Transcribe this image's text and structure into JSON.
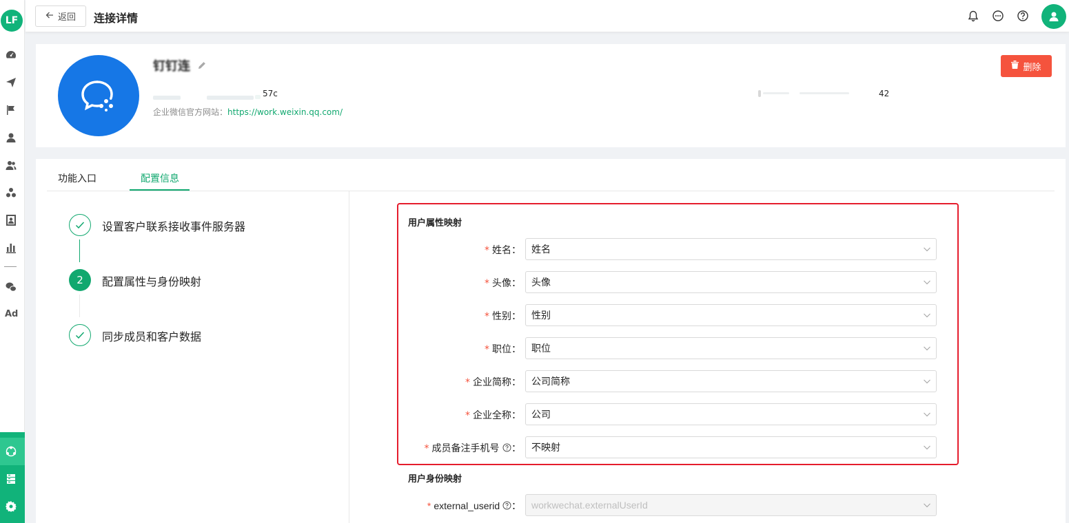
{
  "nav": {
    "logo_text": "LF",
    "ad_label": "Ad",
    "icons": [
      "dashboard-icon",
      "send-icon",
      "flag-icon",
      "user-icon",
      "users-icon",
      "group-icon",
      "contact-card-icon",
      "bar-chart-icon",
      "wechat-icon",
      "connector-icon",
      "storage-icon",
      "settings-icon"
    ]
  },
  "header": {
    "back_label": "返回",
    "title": "连接详情"
  },
  "profile": {
    "name": "钉钉连",
    "id_suffix": "57c",
    "website_label": "企业微信官方网站：",
    "website_url": "https://work.weixin.qq.com/",
    "time_suffix": "42",
    "delete_label": "删除"
  },
  "tabs": [
    {
      "label": "功能入口",
      "active": false
    },
    {
      "label": "配置信息",
      "active": true
    }
  ],
  "steps": [
    {
      "label": "设置客户联系接收事件服务器",
      "status": "done"
    },
    {
      "label": "配置属性与身份映射",
      "status": "current",
      "number": "2"
    },
    {
      "label": "同步成员和客户数据",
      "status": "done"
    }
  ],
  "attr_mapping": {
    "title": "用户属性映射",
    "fields": [
      {
        "label": "姓名",
        "suffix": "：",
        "value": "姓名"
      },
      {
        "label": "头像",
        "suffix": "：",
        "value": "头像"
      },
      {
        "label": "性别",
        "suffix": "：",
        "value": "性别"
      },
      {
        "label": "职位",
        "suffix": "：",
        "value": "职位"
      },
      {
        "label": "企业简称",
        "suffix": "：",
        "value": "公司简称"
      },
      {
        "label": "企业全称",
        "suffix": "：",
        "value": "公司"
      },
      {
        "label": "成员备注手机号",
        "suffix": "：",
        "value": "不映射"
      }
    ]
  },
  "identity_mapping": {
    "title": "用户身份映射",
    "fields": [
      {
        "label": "external_userid",
        "suffix": "：",
        "value": "workwechat.externalUserId",
        "disabled": true
      }
    ]
  },
  "colors": {
    "accent": "#11a86f",
    "danger": "#f5533d",
    "highlight_border": "#e51c2c",
    "wechat_blue": "#1677e6"
  }
}
